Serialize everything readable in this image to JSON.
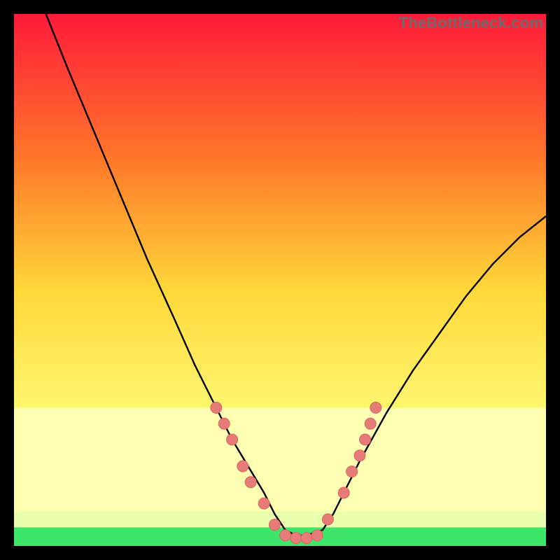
{
  "watermark": "TheBottleneck.com",
  "colors": {
    "curve": "#000000",
    "marker_fill": "#e77b78",
    "marker_stroke": "#d86662",
    "green_band": "#3ee66a",
    "frame_bg": "#000000",
    "gradient_top": "#ff1a3a",
    "gradient_mid_upper": "#ff7a2a",
    "gradient_mid": "#ffd83a",
    "gradient_mid_lower": "#fff36b",
    "gradient_bottom_yellow": "#f7ff60"
  },
  "chart_data": {
    "type": "line",
    "title": "",
    "xlabel": "",
    "ylabel": "",
    "xlim": [
      0,
      100
    ],
    "ylim": [
      0,
      100
    ],
    "series": [
      {
        "name": "bottleneck-curve",
        "x": [
          6,
          10,
          15,
          20,
          25,
          30,
          34,
          38,
          41,
          44,
          47,
          49,
          51,
          53,
          55,
          58,
          60,
          62,
          65,
          70,
          75,
          80,
          85,
          90,
          95,
          100
        ],
        "y": [
          100,
          90,
          78,
          66,
          54,
          43,
          34,
          26,
          20,
          15,
          10,
          6,
          3,
          2,
          2,
          3,
          6,
          10,
          16,
          25,
          33,
          40,
          47,
          53,
          58,
          62
        ]
      }
    ],
    "markers": [
      {
        "x": 38,
        "y": 26
      },
      {
        "x": 39.5,
        "y": 23
      },
      {
        "x": 41,
        "y": 20
      },
      {
        "x": 43,
        "y": 15
      },
      {
        "x": 44.5,
        "y": 12
      },
      {
        "x": 47,
        "y": 8
      },
      {
        "x": 49,
        "y": 4
      },
      {
        "x": 51,
        "y": 2
      },
      {
        "x": 53,
        "y": 1.5
      },
      {
        "x": 55,
        "y": 1.5
      },
      {
        "x": 57,
        "y": 2
      },
      {
        "x": 59,
        "y": 5
      },
      {
        "x": 62,
        "y": 10
      },
      {
        "x": 63.5,
        "y": 14
      },
      {
        "x": 65,
        "y": 17
      },
      {
        "x": 66,
        "y": 20
      },
      {
        "x": 67,
        "y": 23
      },
      {
        "x": 68,
        "y": 26
      }
    ],
    "green_band_y": 1.5,
    "yellow_band_top_y": 26
  }
}
